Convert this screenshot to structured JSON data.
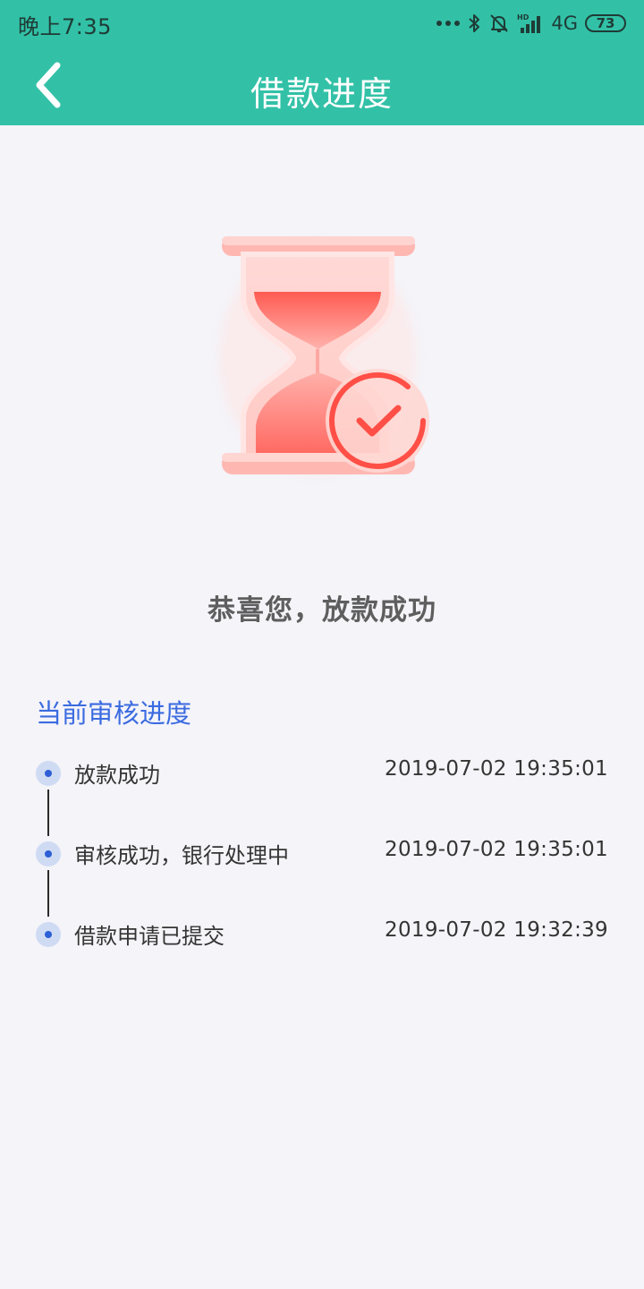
{
  "status_bar": {
    "time": "晚上7:35",
    "network": "4G",
    "battery": "73",
    "icons": [
      "more-dots-icon",
      "bluetooth-icon",
      "mute-bell-icon",
      "signal-icon",
      "battery-icon"
    ]
  },
  "header": {
    "title": "借款进度",
    "back_icon": "chevron-left-icon"
  },
  "result": {
    "message": "恭喜您，放款成功",
    "icon": "hourglass-check-icon"
  },
  "progress": {
    "title": "当前审核进度",
    "items": [
      {
        "label": "放款成功",
        "time": "2019-07-02 19:35:01"
      },
      {
        "label": "审核成功，银行处理中",
        "time": "2019-07-02 19:35:01"
      },
      {
        "label": "借款申请已提交",
        "time": "2019-07-02 19:32:39"
      }
    ]
  },
  "colors": {
    "header": "#32c1a7",
    "accent": "#3b6be0",
    "background": "#f4f4f9",
    "hourglass": "#ff6b63"
  }
}
